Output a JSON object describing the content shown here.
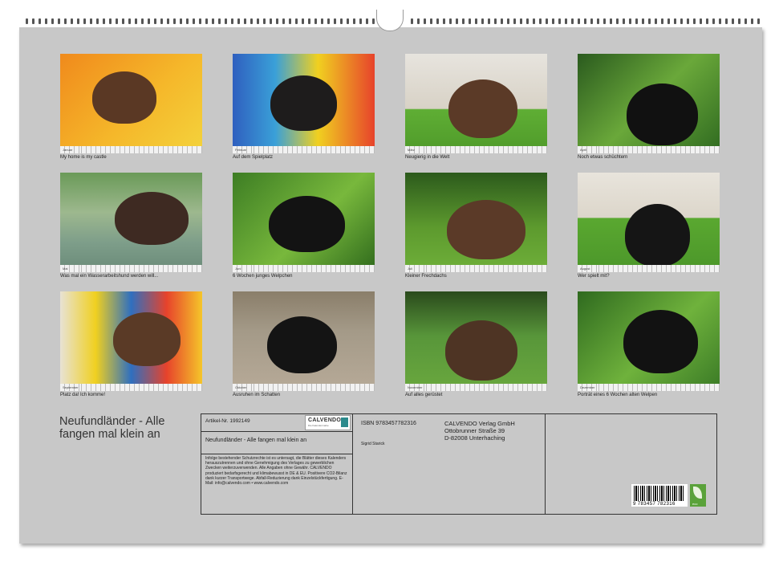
{
  "photos": [
    {
      "caption": "My home is my castle",
      "month": "Januar",
      "bg": "linear-gradient(135deg,#f08a1c 0%,#f5b72a 55%,#f3d33c 100%)",
      "dog": "#5a3824"
    },
    {
      "caption": "Auf dem Spielplatz",
      "month": "Februar",
      "bg": "linear-gradient(90deg,#2f5fbf 0%,#3aa0d8 30%,#f0d020 60%,#e7432b 100%)",
      "dog": "#1e1c1c"
    },
    {
      "caption": "Neugierig in die Welt",
      "month": "März",
      "bg": "linear-gradient(180deg,#e7e4de 0%,#d8d2c6 55%,#5fae34 56%,#4f9a2a 100%)",
      "dog": "#5b3a27"
    },
    {
      "caption": "Noch etwas schüchtern",
      "month": "April",
      "bg": "linear-gradient(135deg,#2a5a1e 0%,#6aa83a 50%,#2f6a20 100%)",
      "dog": "#111111"
    },
    {
      "caption": "Was mal ein Wasserarbeitshund werden will...",
      "month": "Mai",
      "bg": "linear-gradient(180deg,#6a9a58 0%,#9db88e 40%,#7e9e8a 70%,#6a8a78 100%)",
      "dog": "#3e2a22"
    },
    {
      "caption": "6 Wochen junges Welpchen",
      "month": "Juni",
      "bg": "linear-gradient(135deg,#3d7d24 0%,#78b83c 55%,#2f6a1c 100%)",
      "dog": "#131313"
    },
    {
      "caption": "Kleiner Frechdachs",
      "month": "Juli",
      "bg": "linear-gradient(180deg,#2c5a1c 0%,#5d9a2e 55%,#6fb03a 100%)",
      "dog": "#5b3a28"
    },
    {
      "caption": "Wer spielt mit?",
      "month": "August",
      "bg": "linear-gradient(180deg,#e8e4dc 0%,#dcd6ca 45%,#5aa830 46%,#4b962a 100%)",
      "dog": "#151515"
    },
    {
      "caption": "Platz da! Ich komme!",
      "month": "September",
      "bg": "linear-gradient(90deg,#e8e2d4 0%,#f0d020 25%,#2f6fbf 50%,#e7432b 75%,#f5c52a 100%)",
      "dog": "#5a3a26"
    },
    {
      "caption": "Ausruhen im Schatten",
      "month": "Oktober",
      "bg": "linear-gradient(180deg,#8a7e6a 0%,#a49a88 40%,#b7aa98 100%)",
      "dog": "#141414"
    },
    {
      "caption": "Auf alles gerüstet",
      "month": "November",
      "bg": "linear-gradient(180deg,#2a4a1c 0%,#58963a 45%,#6aa83e 100%)",
      "dog": "#4e3424"
    },
    {
      "caption": "Porträt eines 6 Wochen alten Welpen",
      "month": "Dezember",
      "bg": "linear-gradient(135deg,#2f6a1f 0%,#6fb23c 55%,#3a7a26 100%)",
      "dog": "#121212"
    }
  ],
  "title": "Neufundländer - Alle fangen mal klein an",
  "article": "Artikel-Nr. 1992149",
  "isbn": "ISBN 9783457782316",
  "subtitle": "Neufundländer - Alle fangen mal klein an",
  "author": "Sigrid Starick",
  "publisher": {
    "name": "CALVENDO Verlag GmbH",
    "street": "Ottobrunner Straße 39",
    "city": "D-82008 Unterhaching"
  },
  "logo": {
    "name": "CALVENDO",
    "tag": "Die Kalendermarke"
  },
  "legal": "Infolge bestehender Schutzrechte ist es untersagt, die Blätter dieses Kalenders herauszutrennen und ohne Genehmigung des Verlages zu gewerblichen Zwecken weiterzuverwenden. Alle Angaben ohne Gewähr. CALVENDO produziert bedarfsgerecht und klimabewusst in DE & EU. Positivere CO2-Bilanz dank kurzer Transportwege. Abfall-Reduzierung dank Einzelstückfertigung. E-Mail: info@calvendo.com • www.calvendo.com",
  "barcode": "9 783457 782316",
  "eco": "eco"
}
